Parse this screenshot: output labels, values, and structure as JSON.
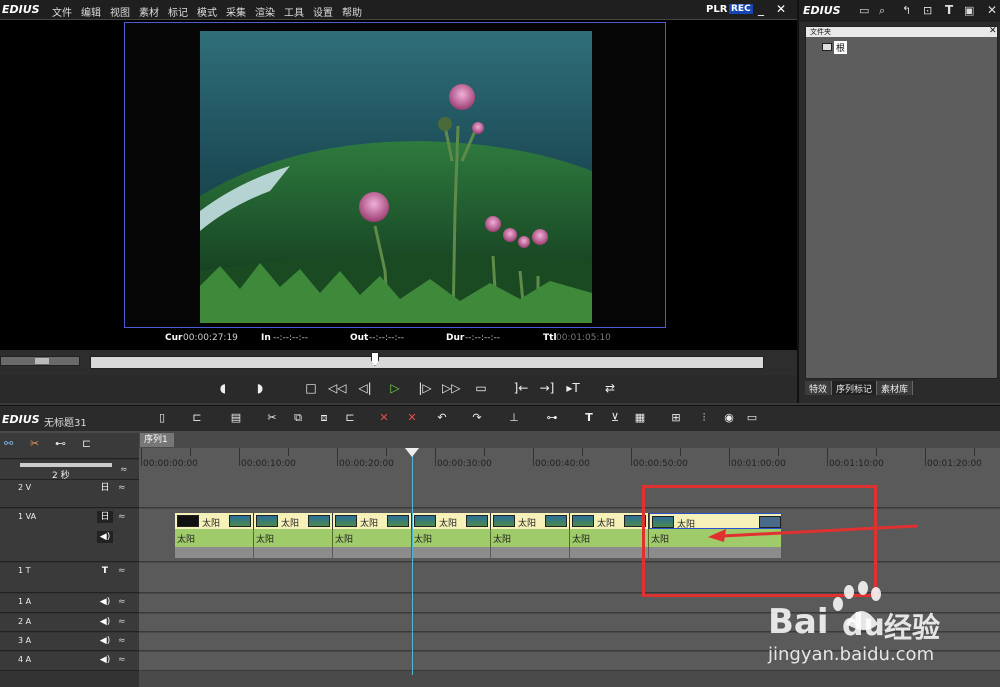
{
  "app": {
    "logo": "EDIUS",
    "menu": [
      "文件",
      "编辑",
      "视图",
      "素材",
      "标记",
      "模式",
      "采集",
      "渲染",
      "工具",
      "设置",
      "帮助"
    ],
    "plr": "PLR",
    "rec": "REC"
  },
  "monitor": {
    "cur_label": "Cur",
    "cur_value": "00:00:27:19",
    "in_label": "In",
    "in_value": "--:--:--:--",
    "out_label": "Out",
    "out_value": "--:--:--:--",
    "dur_label": "Dur",
    "dur_value": "--:--:--:--",
    "ttl_label": "Ttl",
    "ttl_value": "00:01:05:10"
  },
  "bin": {
    "logo": "EDIUS",
    "folder_title": "文件夹",
    "root_label": "根",
    "tabs": [
      "特效",
      "序列标记",
      "素材库"
    ],
    "active_tab": 1
  },
  "timeline": {
    "logo": "EDIUS",
    "project_name": "无标题31",
    "sequence_tab": "序列1",
    "zoom_label": "2 秒",
    "ruler_labels": [
      "00:00:00:00",
      "00:00:10:00",
      "00:00:20:00",
      "00:00:30:00",
      "00:00:40:00",
      "00:00:50:00",
      "00:01:00:00",
      "00:01:10:00",
      "00:01:20:00"
    ],
    "tracks": {
      "v2": "2 V",
      "va1": "1 VA",
      "t1": "1 T",
      "a1": "1 A",
      "a2": "2 A",
      "a3": "3 A",
      "a4": "4 A"
    },
    "clip_name": "太阳",
    "clips_count": 7
  },
  "watermark": {
    "brand": "Bai",
    "brand2": "du",
    "cn": "经验",
    "url": "jingyan.baidu.com"
  },
  "colors": {
    "accent_blue": "#1646b4",
    "clip_video": "#f5f1b8",
    "clip_audio": "#9fcb6a",
    "highlight": "#e03030",
    "playline": "#4fb6d8"
  }
}
